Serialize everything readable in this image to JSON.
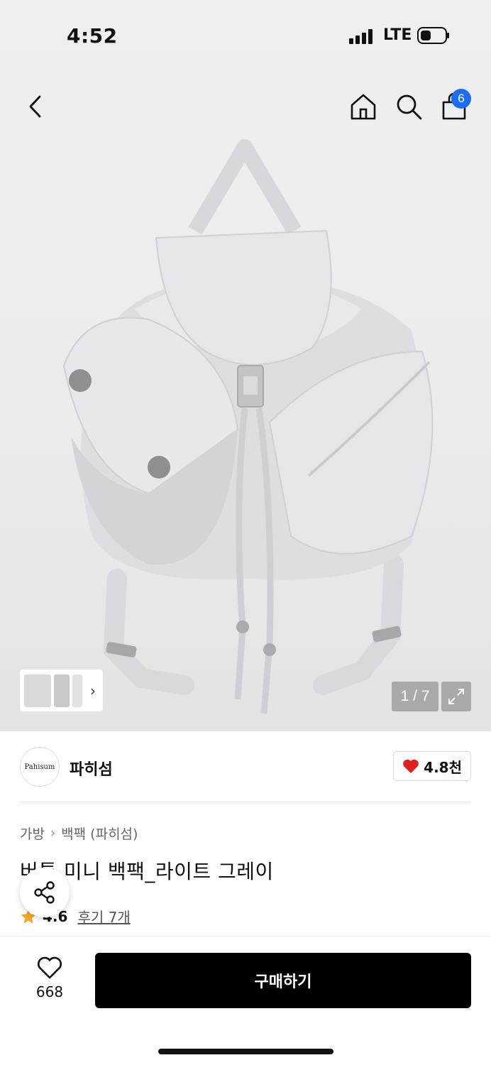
{
  "status_bar": {
    "time": "4:52",
    "network": "LTE"
  },
  "navbar": {
    "cart_count": "6"
  },
  "gallery": {
    "counter": "1 / 7"
  },
  "brand": {
    "logo_text": "Pahisum",
    "name": "파히섬",
    "likes": "4.8천"
  },
  "breadcrumb": {
    "category": "가방",
    "subcategory": "백팩 (파히섬)"
  },
  "product": {
    "title": "버튼 미니 백팩_라이트 그레이",
    "rating": "4.6",
    "reviews": "후기 7개"
  },
  "bottom_bar": {
    "wish_count": "668",
    "buy_label": "구매하기"
  },
  "colors": {
    "accent": "#1a6cf0",
    "heart": "#e02020",
    "star": "#f5a623",
    "buy_bg": "#000000"
  }
}
